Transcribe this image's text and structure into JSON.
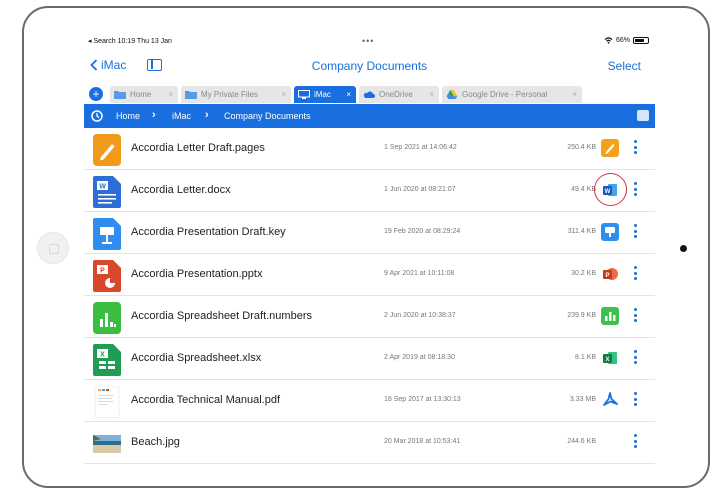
{
  "status_bar": {
    "left": "◂ Search  10:19  Thu 13 Jan",
    "dots": "•••",
    "battery": "66%"
  },
  "nav": {
    "back_label": "iMac",
    "title": "Company Documents",
    "select_label": "Select"
  },
  "tabs": [
    {
      "label": "Home",
      "active": false
    },
    {
      "label": "My Private Files",
      "active": false
    },
    {
      "label": "iMac",
      "active": true
    },
    {
      "label": "OneDrive",
      "active": false
    },
    {
      "label": "Google Drive - Personal",
      "active": false
    }
  ],
  "breadcrumb": [
    "Home",
    "iMac",
    "Company Documents"
  ],
  "files": [
    {
      "name": "Accordia Letter Draft.pages",
      "date": "1 Sep 2021 at 14:06:42",
      "size": "250.4 KB",
      "type": "pages"
    },
    {
      "name": "Accordia Letter.docx",
      "date": "1 Jun 2020 at 08:21:07",
      "size": "49.4 KB",
      "type": "word"
    },
    {
      "name": "Accordia Presentation Draft.key",
      "date": "19 Feb 2020 at 08:29:24",
      "size": "311.4 KB",
      "type": "keynote"
    },
    {
      "name": "Accordia Presentation.pptx",
      "date": "9 Apr 2021 at 10:11:08",
      "size": "30.2 KB",
      "type": "powerpoint"
    },
    {
      "name": "Accordia Spreadsheet Draft.numbers",
      "date": "2 Jun 2020 at 10:38:37",
      "size": "239.9 KB",
      "type": "numbers"
    },
    {
      "name": "Accordia Spreadsheet.xlsx",
      "date": "2 Apr 2019 at 08:18:30",
      "size": "8.1 KB",
      "type": "excel"
    },
    {
      "name": "Accordia Technical Manual.pdf",
      "date": "18 Sep 2017 at 13:30:13",
      "size": "3.33 MB",
      "type": "pdf"
    },
    {
      "name": "Beach.jpg",
      "date": "20 Mar 2018 at 10:53:41",
      "size": "244.6 KB",
      "type": "image"
    }
  ],
  "colors": {
    "accent": "#1a6fe0",
    "highlight": "#d6303a"
  }
}
